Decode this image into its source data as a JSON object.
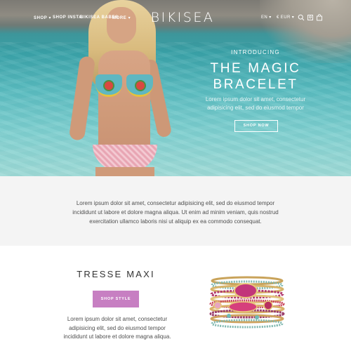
{
  "nav": {
    "links": [
      "SHOP ▾",
      "SHOP INSTA",
      "BIKISEA BABES",
      "MORE ▾"
    ],
    "logo": "BIKISEA",
    "language": "EN ▾",
    "currency": "€ EUR ▾",
    "icons": [
      "search-icon",
      "account-icon",
      "bag-icon"
    ]
  },
  "hero": {
    "eyebrow": "INTRODUCING",
    "title": "THE MAGIC BRACELET",
    "copy": "Lorem ipsum dolor sit amet, consectetur adipisicing elit, sed do eiusmod tempor",
    "button": "SHOP NOW"
  },
  "intro": {
    "text": "Lorem ipsum dolor sit amet, consectetur adipisicing elit, sed do eiusmod tempor incididunt ut labore et dolore magna aliqua. Ut enim ad minim veniam, quis nostrud exercitation ullamco laboris nisi ut aliquip ex ea commodo consequat."
  },
  "product": {
    "title": "TRESSE MAXI",
    "button": "SHOP STYLE",
    "copy": "Lorem ipsum dolor sit amet, consectetur adipisicing elit, sed do eiusmod tempor incididunt ut labore et dolore magna aliqua."
  },
  "colors": {
    "accent": "#c77fc2",
    "intro_bg": "#f4f4f4",
    "water": "#3aa2a8"
  }
}
